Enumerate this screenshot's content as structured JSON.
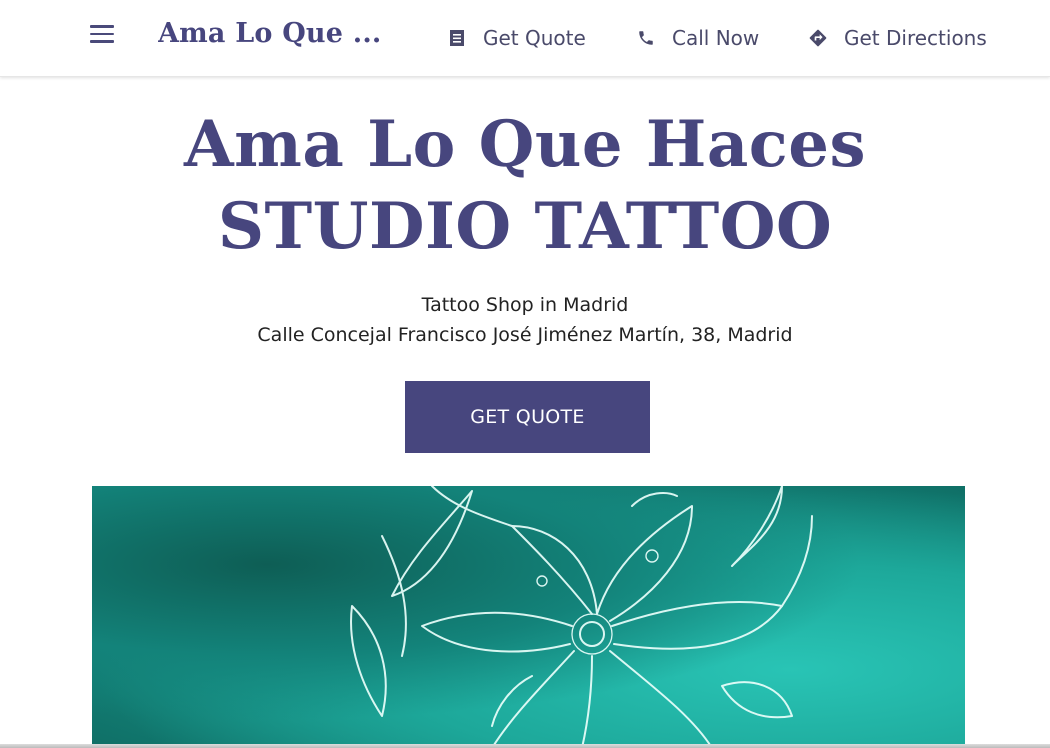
{
  "header": {
    "brand": "Ama Lo Que ...",
    "nav": [
      {
        "label": "Get Quote",
        "icon": "receipt-icon"
      },
      {
        "label": "Call Now",
        "icon": "phone-icon"
      },
      {
        "label": "Get Directions",
        "icon": "directions-icon"
      }
    ]
  },
  "hero": {
    "title_line1": "Ama Lo Que Haces",
    "title_line2": "STUDIO TATTOO",
    "subtitle": "Tattoo Shop in Madrid",
    "address": "Calle Concejal Francisco José Jiménez Martín, 38, Madrid",
    "cta_label": "GET QUOTE"
  },
  "colors": {
    "brand": "#47467e",
    "image_teal": "#1b9b8e"
  }
}
